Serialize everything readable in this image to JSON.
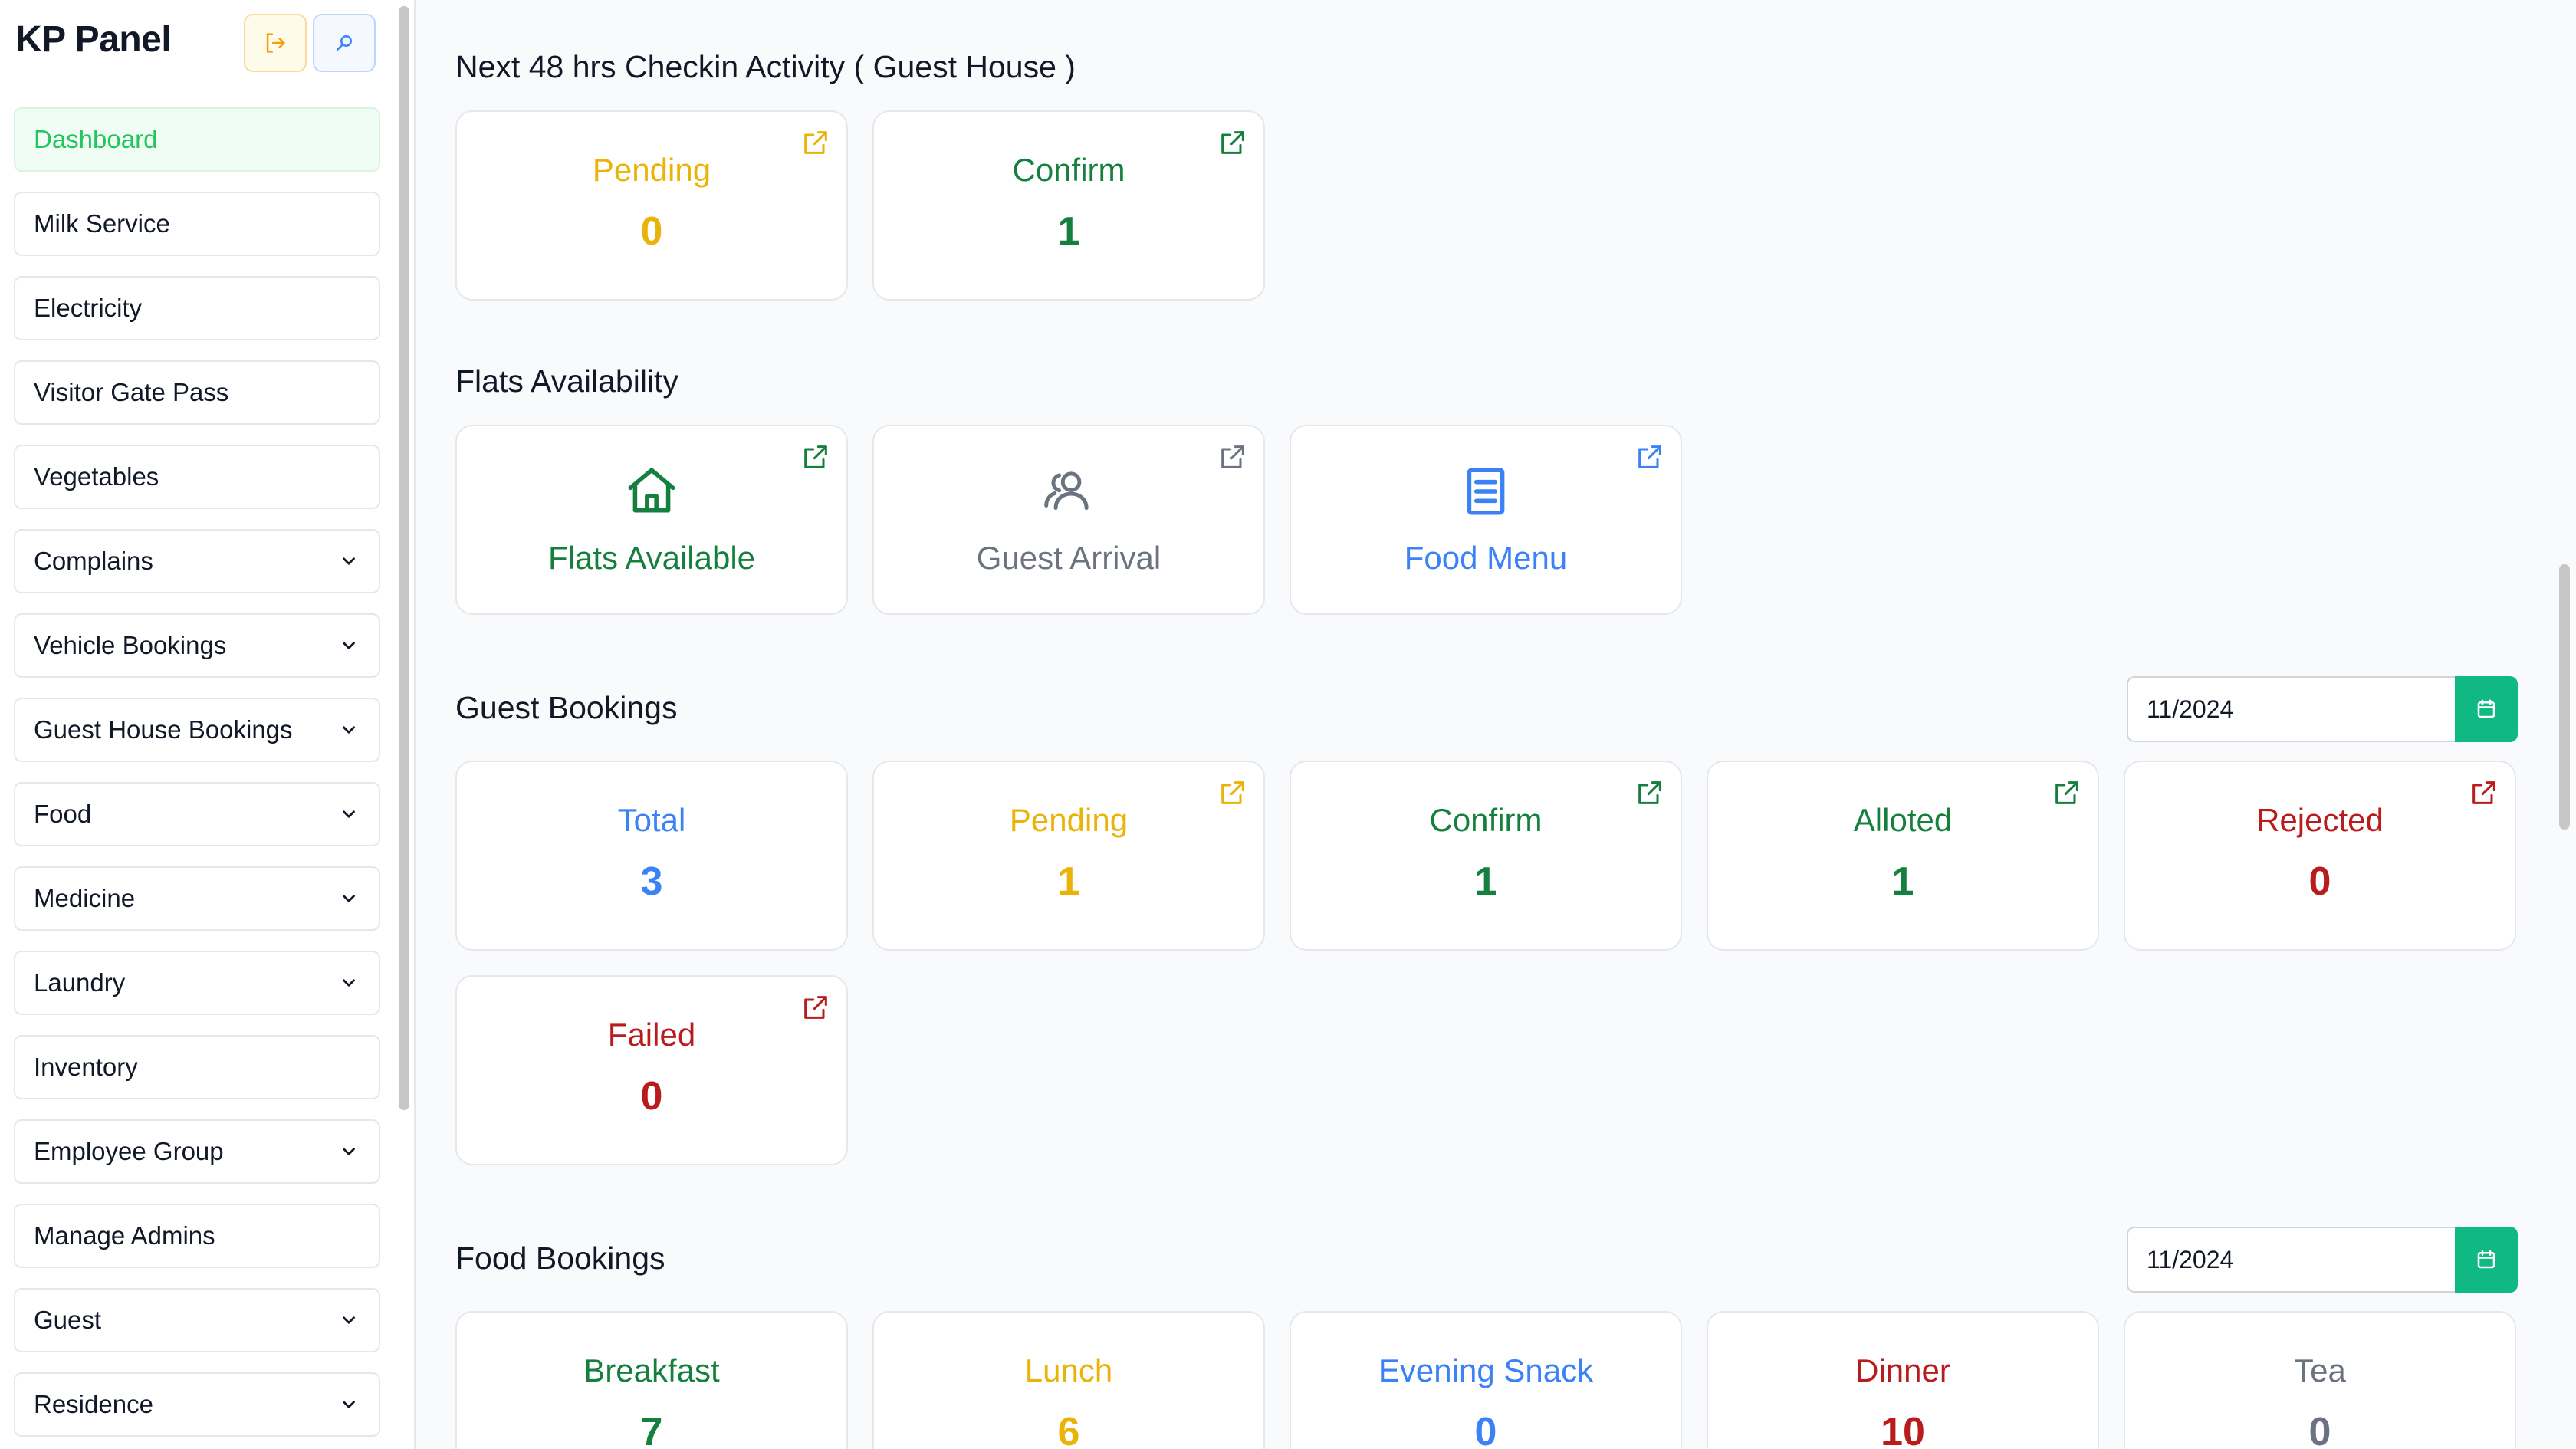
{
  "app": {
    "title": "KP Panel"
  },
  "sidebar": {
    "items": [
      {
        "label": "Dashboard",
        "active": true,
        "has_chevron": false
      },
      {
        "label": "Milk Service",
        "has_chevron": false
      },
      {
        "label": "Electricity",
        "has_chevron": false
      },
      {
        "label": "Visitor Gate Pass",
        "has_chevron": false
      },
      {
        "label": "Vegetables",
        "has_chevron": false
      },
      {
        "label": "Complains",
        "has_chevron": true
      },
      {
        "label": "Vehicle Bookings",
        "has_chevron": true
      },
      {
        "label": "Guest House Bookings",
        "has_chevron": true
      },
      {
        "label": "Food",
        "has_chevron": true
      },
      {
        "label": "Medicine",
        "has_chevron": true
      },
      {
        "label": "Laundry",
        "has_chevron": true
      },
      {
        "label": "Inventory",
        "has_chevron": false
      },
      {
        "label": "Employee Group",
        "has_chevron": true
      },
      {
        "label": "Manage Admins",
        "has_chevron": false
      },
      {
        "label": "Guest",
        "has_chevron": true
      },
      {
        "label": "Residence",
        "has_chevron": true
      }
    ]
  },
  "colors": {
    "pending": "#eab308",
    "confirm": "#15803d",
    "total": "#3b82f6",
    "rejected": "#b91c1c",
    "neutral": "#6b7280",
    "accent": "#10b981"
  },
  "checkin": {
    "title": "Next 48 hrs Checkin Activity ( Guest House )",
    "cards": [
      {
        "label": "Pending",
        "value": "0"
      },
      {
        "label": "Confirm",
        "value": "1"
      }
    ]
  },
  "flats": {
    "title": "Flats Availability",
    "cards": [
      {
        "label": "Flats Available",
        "icon": "home-icon"
      },
      {
        "label": "Guest Arrival",
        "icon": "users-icon"
      },
      {
        "label": "Food Menu",
        "icon": "menu-book-icon"
      }
    ]
  },
  "guest_bookings": {
    "title": "Guest Bookings",
    "date": "11/2024",
    "cards": [
      {
        "label": "Total",
        "value": "3"
      },
      {
        "label": "Pending",
        "value": "1"
      },
      {
        "label": "Confirm",
        "value": "1"
      },
      {
        "label": "Alloted",
        "value": "1"
      },
      {
        "label": "Rejected",
        "value": "0"
      },
      {
        "label": "Failed",
        "value": "0"
      }
    ]
  },
  "food_bookings": {
    "title": "Food Bookings",
    "date": "11/2024",
    "cards": [
      {
        "label": "Breakfast",
        "value": "7"
      },
      {
        "label": "Lunch",
        "value": "6"
      },
      {
        "label": "Evening Snack",
        "value": "0"
      },
      {
        "label": "Dinner",
        "value": "10"
      },
      {
        "label": "Tea",
        "value": "0"
      }
    ]
  }
}
